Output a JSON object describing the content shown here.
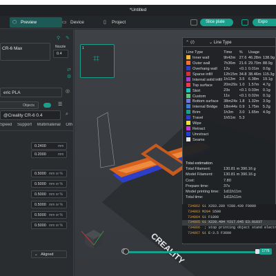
{
  "title": "*Untitled",
  "toolbar": {
    "tabs": [
      {
        "label": "Preview"
      },
      {
        "label": "Device"
      },
      {
        "label": "Project"
      }
    ],
    "slice_label": "Slice plate",
    "export_label": "Expo"
  },
  "left": {
    "printer_name": "CR-6 Max",
    "nozzle_label": "Nozzle",
    "nozzle_value": "0.4",
    "filament": "eric PLA",
    "objects_label": "Objects",
    "process_preset": "@Creality CR-6 0.4",
    "process_tabs": [
      "Speed",
      "Support",
      "Multimaterial",
      "Oth"
    ],
    "mm_fields": [
      {
        "value": "0.2400",
        "unit": "mm"
      },
      {
        "value": "0.2000",
        "unit": "mm"
      }
    ],
    "pct_fields": [
      {
        "value": "0.5000",
        "unit": "mm or %"
      },
      {
        "value": "0.5000",
        "unit": "mm or %"
      },
      {
        "value": "0.5000",
        "unit": "mm or %"
      },
      {
        "value": "0.5000",
        "unit": "mm or %"
      },
      {
        "value": "0.5000",
        "unit": "mm or %"
      },
      {
        "value": "0.5000",
        "unit": "mm or %"
      }
    ],
    "aligned": "Aligned"
  },
  "viewport": {
    "plate_number": "1",
    "bed_brand": "CREALITY"
  },
  "legend": {
    "dropdown": "Line Type",
    "headers": [
      "Line Type",
      "Time",
      "%",
      "Usage"
    ],
    "rows": [
      {
        "name": "Inner wall",
        "time": "9h42m",
        "pct": "27.6",
        "usage": "46.28m",
        "g": "138.9g",
        "color": "#f6b73c"
      },
      {
        "name": "Outer wall",
        "time": "7h36m",
        "pct": "21.6",
        "usage": "29.70m",
        "g": "88.9g",
        "color": "#f4702e"
      },
      {
        "name": "Overhang wall",
        "time": "12s",
        "pct": "<0.1",
        "usage": "0.01m",
        "g": "0.0g",
        "color": "#2e3fd0"
      },
      {
        "name": "Sparse infill",
        "time": "12h15m",
        "pct": "34.8",
        "usage": "38.46m",
        "g": "115.3g",
        "color": "#d1323b"
      },
      {
        "name": "Internal solid infill",
        "time": "1h13m",
        "pct": "3.5",
        "usage": "6.38m",
        "g": "19.1g",
        "color": "#a23ed1"
      },
      {
        "name": "Top surface",
        "time": "20m29s",
        "pct": "1.0",
        "usage": "1.57m",
        "g": "4.7g",
        "color": "#ee3a4a"
      },
      {
        "name": "Skirt",
        "time": "23s",
        "pct": "<0.1",
        "usage": "0.03m",
        "g": "0.1g",
        "color": "#1ac7c2"
      },
      {
        "name": "Custom",
        "time": "11s",
        "pct": "<0.1",
        "usage": "0.02m",
        "g": "0.1g",
        "color": "#5ec87a"
      },
      {
        "name": "Bottom surface",
        "time": "38m24s",
        "pct": "1.8",
        "usage": "1.32m",
        "g": "3.9g",
        "color": "#6d78e0"
      },
      {
        "name": "Internal Bridge",
        "time": "18m44s",
        "pct": "0.9",
        "usage": "1.75m",
        "g": "5.2g",
        "color": "#3a7fd6"
      },
      {
        "name": "Brim",
        "time": "1h3m",
        "pct": "3.0",
        "usage": "1.65m",
        "g": "4.9g",
        "color": "#18a08d"
      },
      {
        "name": "Travel",
        "time": "1h51m",
        "pct": "5.3",
        "usage": "",
        "g": "",
        "color": "#2e3fd0"
      },
      {
        "name": "Wipe",
        "time": "",
        "pct": "",
        "usage": "",
        "g": "",
        "color": "#f0e13a"
      },
      {
        "name": "Retract",
        "time": "",
        "pct": "",
        "usage": "",
        "g": "",
        "color": "#c23ad6"
      },
      {
        "name": "Unretract",
        "time": "",
        "pct": "",
        "usage": "",
        "g": "",
        "color": "#1b45d6"
      },
      {
        "name": "Seams",
        "time": "",
        "pct": "",
        "usage": "",
        "g": "",
        "color": "#e6e6e6"
      }
    ],
    "estimation_title": "Total estimation",
    "estimation": [
      {
        "label": "Total Filament:",
        "value": "130.81 m   390.16 g"
      },
      {
        "label": "Model Filament:",
        "value": "130.81 m   390.16 g"
      },
      {
        "label": "Cost:",
        "value": "7.80"
      },
      {
        "label": "Prepare time:",
        "value": "37s"
      },
      {
        "label": "Model printing time:",
        "value": "1d11h11m"
      },
      {
        "label": "Total time:",
        "value": "1d11h11m"
      }
    ]
  },
  "gcode": [
    {
      "n": "734862",
      "cmd": "G1",
      "rest": "X283.289 Y280.439 F9000"
    },
    {
      "n": "734863",
      "cmd": "M204",
      "rest": "S500"
    },
    {
      "n": "734864",
      "cmd": "G1",
      "rest": "F1800"
    },
    {
      "n": "734865",
      "cmd": "G1",
      "rest": "X220.494 Y217.645 E3.91037"
    },
    {
      "n": "734866",
      "cmd": "",
      "rest": "; stop printing object stand electribe MX"
    },
    {
      "n": "734867",
      "cmd": "G1",
      "rest": "E-3.5 F3600"
    }
  ],
  "layer_value": "1776"
}
